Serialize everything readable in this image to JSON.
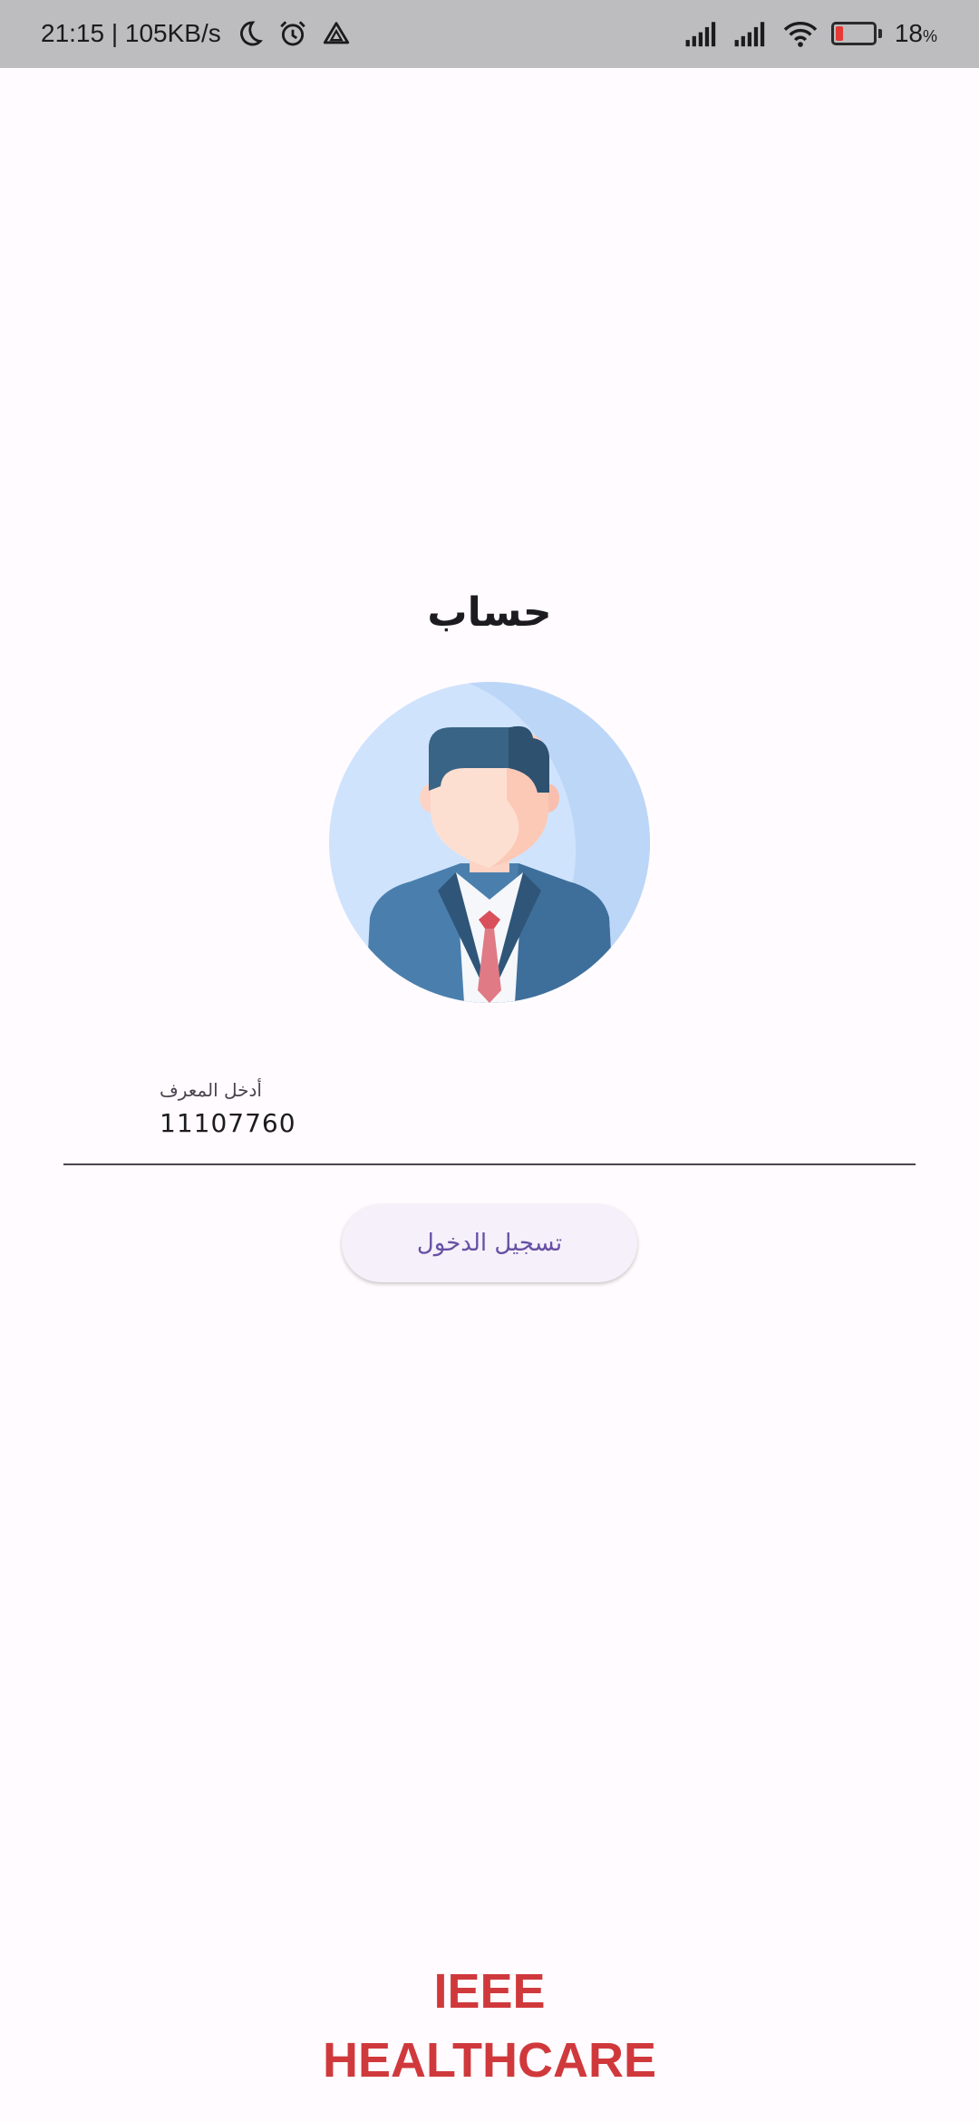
{
  "status_bar": {
    "left_text": "21:15 | 105KB/s",
    "battery_percent": "18",
    "battery_unit": "%",
    "icons": [
      "moon-icon",
      "alarm-icon",
      "drive-icon",
      "signal-icon",
      "signal-icon",
      "wifi-icon",
      "battery-icon"
    ],
    "battery_color": "#e53935"
  },
  "screen": {
    "title": "حساب",
    "avatar_icon": "user-avatar-icon"
  },
  "form": {
    "id_label": "أدخل المعرف",
    "id_value": "11107760",
    "login_label": "تسجيل الدخول"
  },
  "brand": {
    "line1": "IEEE",
    "line2": "HEALTHCARE",
    "color": "#d0393c"
  }
}
